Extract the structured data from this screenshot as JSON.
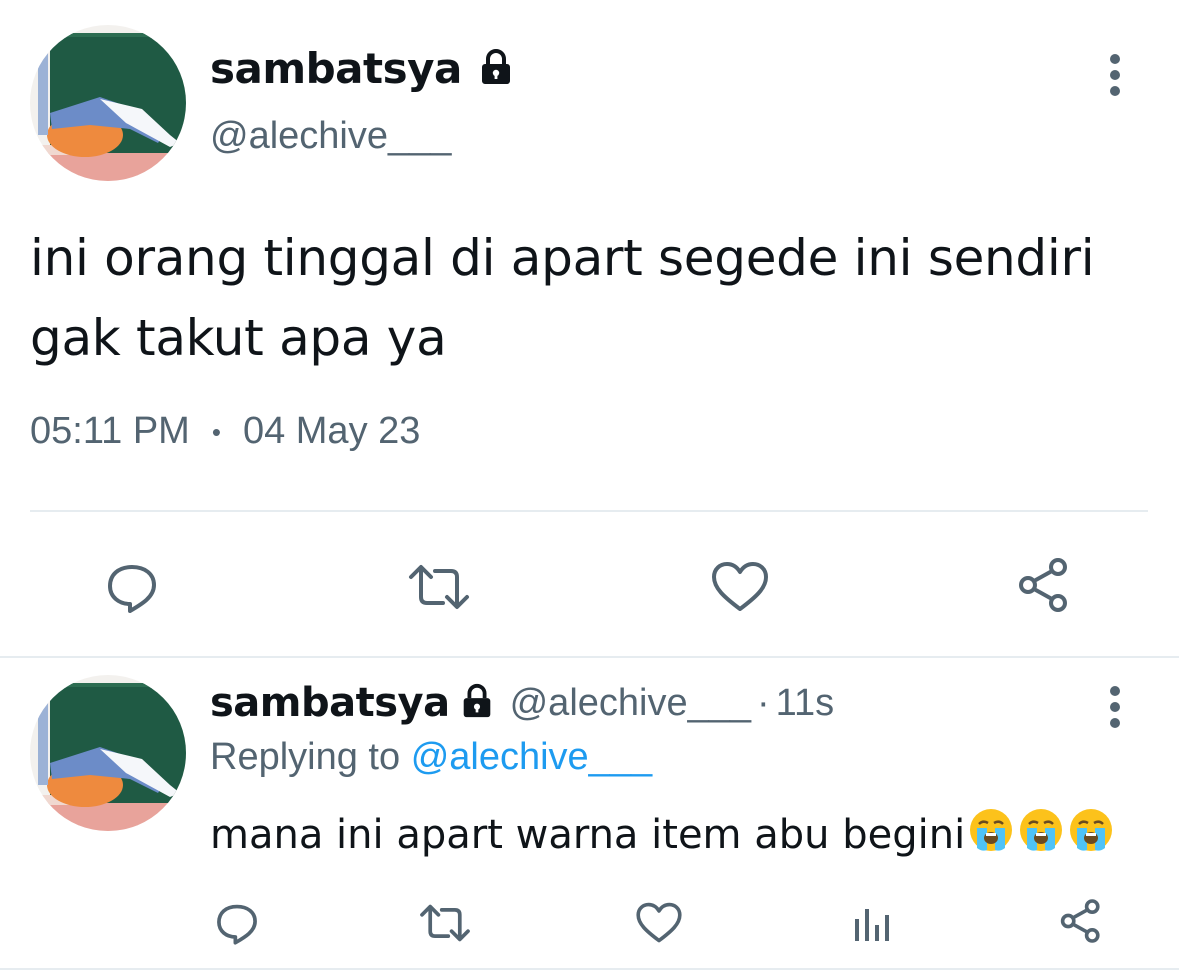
{
  "tweet": {
    "author_name": "sambatsya",
    "author_handle": "@alechive___",
    "text_line1": "ini orang tinggal di apart segede ini sendiri",
    "text_line2": "gak takut apa ya",
    "time": "05:11 PM",
    "separator": "•",
    "date": "04 May 23",
    "actions": [
      "reply-icon",
      "retweet-icon",
      "like-icon",
      "share-icon"
    ]
  },
  "reply": {
    "author_name": "sambatsya",
    "author_handle": "@alechive___",
    "separator": "·",
    "time_ago": "11s",
    "replying_prefix": "Replying to",
    "replying_to": "@alechive___",
    "text": "mana ini apart warna item abu begini",
    "emoji": [
      "loudly-crying-face",
      "loudly-crying-face",
      "loudly-crying-face"
    ],
    "actions": [
      "reply-icon",
      "retweet-icon",
      "like-icon",
      "analytics-icon",
      "share-icon"
    ]
  },
  "colors": {
    "text": "#0f1419",
    "secondary": "#536471",
    "link": "#1d9bf0",
    "divider": "#e6ecf0"
  }
}
